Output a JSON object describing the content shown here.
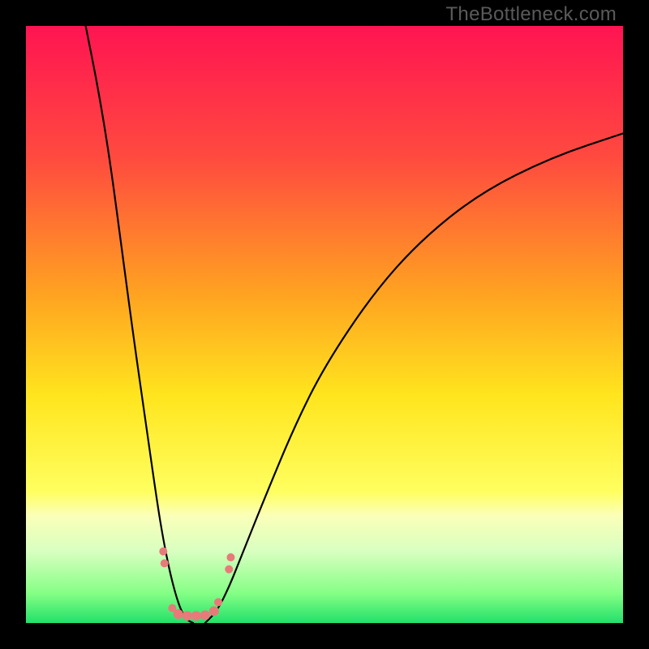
{
  "watermark": "TheBottleneck.com",
  "chart_data": {
    "type": "line",
    "title": "",
    "xlabel": "",
    "ylabel": "",
    "xlim": [
      0,
      100
    ],
    "ylim": [
      0,
      100
    ],
    "grid": false,
    "legend": false,
    "gradient_stops": [
      {
        "pct": 0,
        "color": "#ff1452"
      },
      {
        "pct": 22,
        "color": "#ff4a3f"
      },
      {
        "pct": 45,
        "color": "#ffa321"
      },
      {
        "pct": 62,
        "color": "#ffe51e"
      },
      {
        "pct": 78,
        "color": "#ffff60"
      },
      {
        "pct": 82,
        "color": "#fbffb8"
      },
      {
        "pct": 88,
        "color": "#d8ffc0"
      },
      {
        "pct": 95,
        "color": "#85ff85"
      },
      {
        "pct": 100,
        "color": "#22e06a"
      }
    ],
    "series": [
      {
        "name": "left-curve",
        "x": [
          10,
          12,
          14,
          16,
          18,
          20,
          22,
          23,
          24,
          25,
          26,
          27,
          28
        ],
        "y": [
          100,
          90,
          78,
          63,
          48,
          34,
          20,
          14,
          9,
          5,
          2,
          0.5,
          0
        ]
      },
      {
        "name": "right-curve",
        "x": [
          30,
          32,
          34,
          36,
          40,
          45,
          50,
          58,
          66,
          76,
          88,
          100
        ],
        "y": [
          0,
          2,
          6,
          11,
          21,
          33,
          43,
          55,
          64,
          72,
          78,
          82
        ]
      }
    ],
    "markers": [
      {
        "x": 23.0,
        "y": 12,
        "r": 5
      },
      {
        "x": 23.2,
        "y": 10,
        "r": 5
      },
      {
        "x": 24.5,
        "y": 2.5,
        "r": 5
      },
      {
        "x": 25.5,
        "y": 1.5,
        "r": 6
      },
      {
        "x": 27.0,
        "y": 1.2,
        "r": 6
      },
      {
        "x": 28.5,
        "y": 1.2,
        "r": 6
      },
      {
        "x": 30.0,
        "y": 1.3,
        "r": 6
      },
      {
        "x": 31.5,
        "y": 2.0,
        "r": 6
      },
      {
        "x": 32.2,
        "y": 3.5,
        "r": 5
      },
      {
        "x": 34.0,
        "y": 9.0,
        "r": 5
      },
      {
        "x": 34.3,
        "y": 11.0,
        "r": 5
      }
    ],
    "marker_color": "#e97a7a"
  }
}
